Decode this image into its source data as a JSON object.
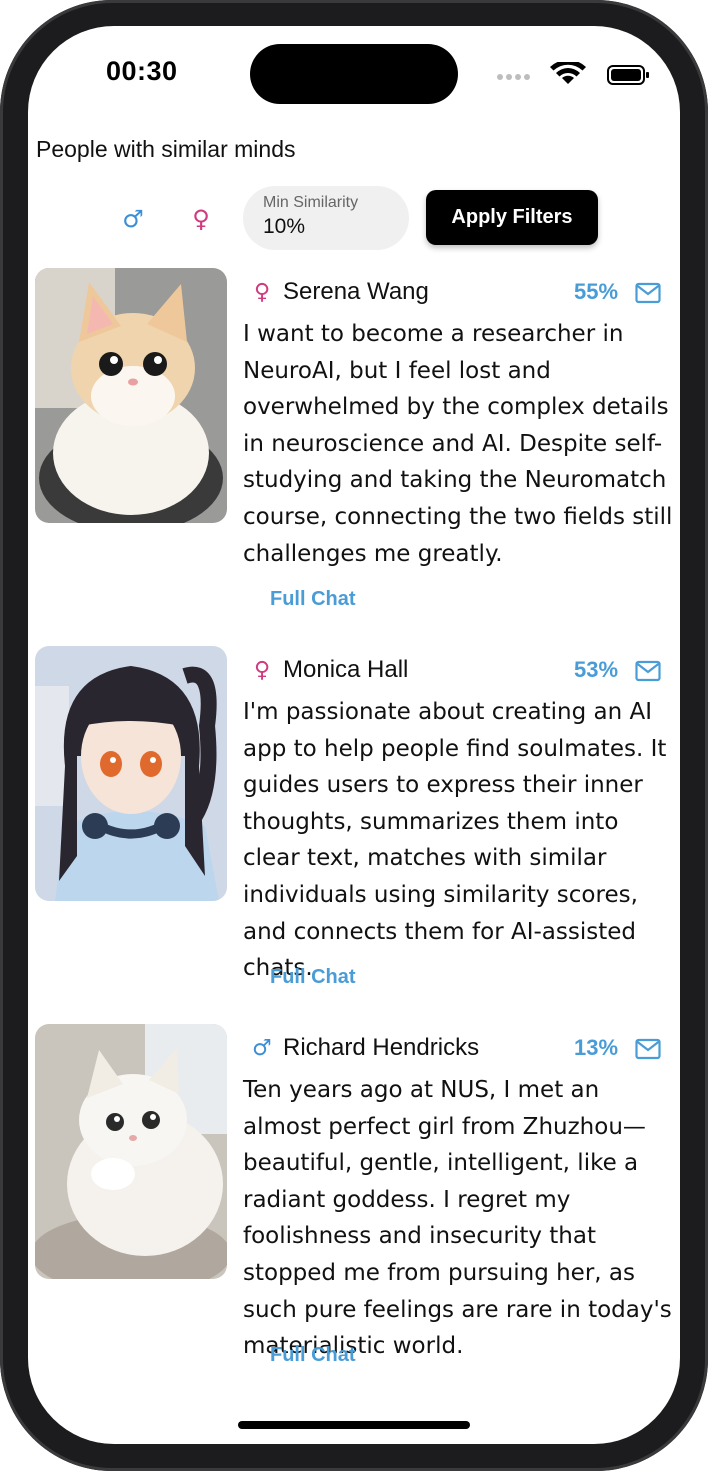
{
  "status_bar": {
    "time": "00:30"
  },
  "page": {
    "title": "People with similar minds"
  },
  "filters": {
    "male_symbol": "♂",
    "female_symbol": "♀",
    "min_similarity_label": "Min Similarity",
    "min_similarity_value": "10%",
    "apply_label": "Apply Filters"
  },
  "profiles": [
    {
      "gender_symbol": "♀",
      "gender_color": "#d03a7e",
      "name": "Serena Wang",
      "similarity": "55%",
      "bio": "I want to become a researcher in NeuroAI, but I feel lost and overwhelmed by the complex details in neuroscience and AI. Despite self-studying and taking the Neuromatch course, connecting the two fields still challenges me greatly.",
      "full_chat_label": "Full Chat",
      "avatar_icon": "cat-avatar"
    },
    {
      "gender_symbol": "♀",
      "gender_color": "#d03a7e",
      "name": "Monica Hall",
      "similarity": "53%",
      "bio": "I'm passionate about creating an AI app to help people find soulmates. It guides users to express their inner thoughts, summarizes them into clear text, matches with similar individuals using similarity scores, and connects them for AI-assisted chats.",
      "full_chat_label": "Full Chat",
      "avatar_icon": "anime-girl-avatar"
    },
    {
      "gender_symbol": "♂",
      "gender_color": "#3d8ed6",
      "name": "Richard Hendricks",
      "similarity": "13%",
      "bio": "Ten years ago at NUS, I met an almost perfect girl from Zhuzhou—beautiful, gentle, intelligent, like a radiant goddess. I regret my foolishness and insecurity that stopped me from pursuing her, as such pure feelings are rare in today's materialistic world.",
      "full_chat_label": "Full Chat",
      "avatar_icon": "white-cat-avatar"
    }
  ],
  "colors": {
    "accent": "#4a9cd6",
    "female": "#d03a7e",
    "male": "#3d8ed6"
  }
}
